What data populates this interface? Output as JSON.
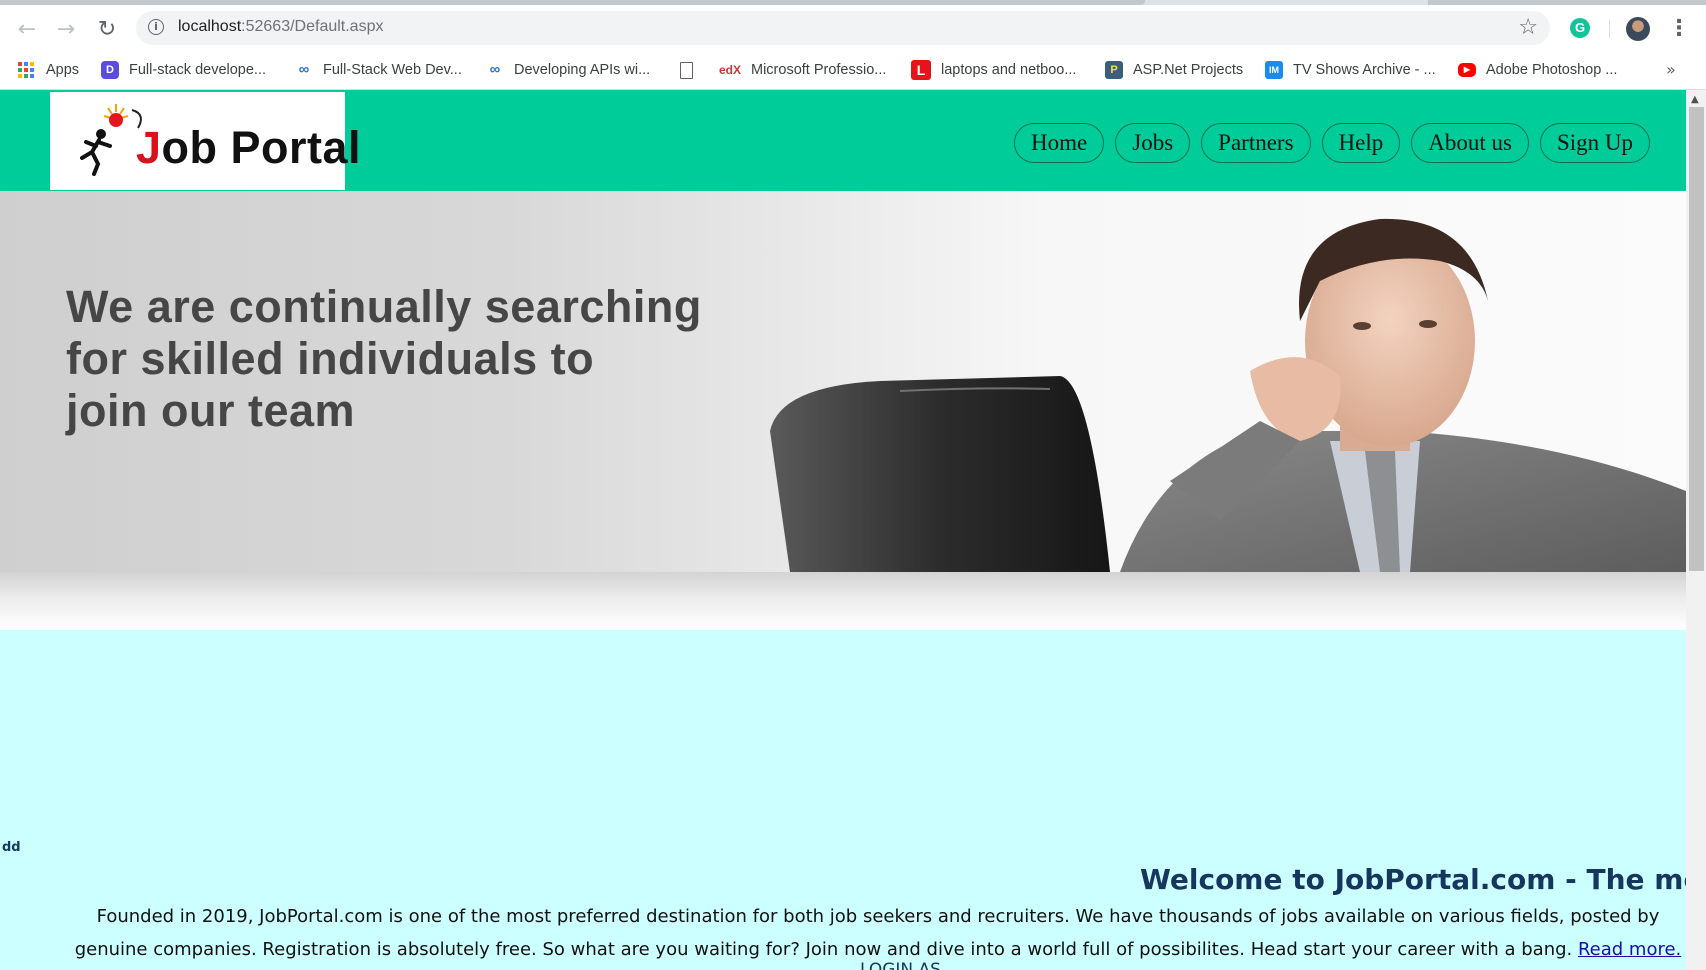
{
  "browser": {
    "url_host": "localhost",
    "url_path": ":52663/Default.aspx",
    "bookmarks": [
      {
        "label": "Apps",
        "icon": "apps-grid-icon"
      },
      {
        "label": "Full-stack develope...",
        "icon": "dev-icon"
      },
      {
        "label": "Full-Stack Web Dev...",
        "icon": "coursera-icon"
      },
      {
        "label": "Developing APIs wi...",
        "icon": "coursera-icon"
      },
      {
        "label": "",
        "icon": "page-icon"
      },
      {
        "label": "Microsoft Professio...",
        "icon": "edx-icon"
      },
      {
        "label": "laptops and netboo...",
        "icon": "l-icon"
      },
      {
        "label": "ASP.Net Projects",
        "icon": "p-icon"
      },
      {
        "label": "TV Shows Archive - ...",
        "icon": "tv-icon"
      },
      {
        "label": "Adobe Photoshop ...",
        "icon": "youtube-icon"
      }
    ],
    "overflow_label": "»"
  },
  "site": {
    "logo": {
      "j": "J",
      "rest": "ob Portal"
    },
    "nav": [
      "Home",
      "Jobs",
      "Partners",
      "Help",
      "About us",
      "Sign Up"
    ],
    "banner": {
      "line1": "We are continually searching",
      "line2": "for skilled individuals to",
      "line3": "join our team"
    },
    "stray_text": "dd",
    "welcome": "Welcome to JobPortal.com - The most",
    "intro": "Founded in 2019, JobPortal.com is one of the most preferred destination for both job seekers and recruiters. We have thousands of jobs available on various fields, posted by genuine companies. Registration is absolutely free. So what are you waiting for? Join now and dive into a world full of possibilites. Head start your career with a bang.",
    "read_more": "Read more.",
    "login_as": "LOGIN AS"
  },
  "colors": {
    "header_green": "#00cc99",
    "content_bg": "#ccffff",
    "heading_navy": "#17365d",
    "logo_red": "#d9111d"
  }
}
